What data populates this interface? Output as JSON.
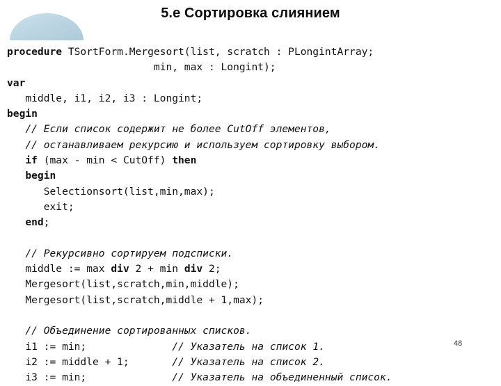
{
  "slide": {
    "title": "5.е Сортировка слиянием",
    "page_number": "48",
    "accent_color": "#bcd6e3",
    "text_color": "#111111",
    "background_color": "#ffffff"
  },
  "decoration": {
    "shape_name": "half-ellipse-dome",
    "fill": "#bcd6e3"
  },
  "code": {
    "language": "Pascal",
    "lines": [
      {
        "id": "l01",
        "segments": [
          {
            "t": "procedure",
            "s": "kw"
          },
          {
            "t": " TSortForm.Mergesort(list, scratch : PLongintArray;",
            "s": "plain"
          }
        ]
      },
      {
        "id": "l02",
        "segments": [
          {
            "t": "                        min, max : Longint);",
            "s": "plain"
          }
        ]
      },
      {
        "id": "l03",
        "segments": [
          {
            "t": "var",
            "s": "kw"
          }
        ]
      },
      {
        "id": "l04",
        "segments": [
          {
            "t": "   middle, i1, i2, i3 : Longint;",
            "s": "plain"
          }
        ]
      },
      {
        "id": "l05",
        "segments": [
          {
            "t": "begin",
            "s": "kw"
          }
        ]
      },
      {
        "id": "l06",
        "segments": [
          {
            "t": "   ",
            "s": "plain"
          },
          {
            "t": "// Если список содержит не более CutOff элементов,",
            "s": "cmt"
          }
        ]
      },
      {
        "id": "l07",
        "segments": [
          {
            "t": "   ",
            "s": "plain"
          },
          {
            "t": "// останавливаем рекурсию и используем сортировку выбором.",
            "s": "cmt"
          }
        ]
      },
      {
        "id": "l08",
        "segments": [
          {
            "t": "   ",
            "s": "plain"
          },
          {
            "t": "if",
            "s": "kw"
          },
          {
            "t": " (max - min < CutOff) ",
            "s": "plain"
          },
          {
            "t": "then",
            "s": "kw"
          }
        ]
      },
      {
        "id": "l09",
        "segments": [
          {
            "t": "   ",
            "s": "plain"
          },
          {
            "t": "begin",
            "s": "kw"
          }
        ]
      },
      {
        "id": "l10",
        "segments": [
          {
            "t": "      Selectionsort(list,min,max);",
            "s": "plain"
          }
        ]
      },
      {
        "id": "l11",
        "segments": [
          {
            "t": "      exit;",
            "s": "plain"
          }
        ]
      },
      {
        "id": "l12",
        "segments": [
          {
            "t": "   ",
            "s": "plain"
          },
          {
            "t": "end",
            "s": "kw"
          },
          {
            "t": ";",
            "s": "plain"
          }
        ]
      },
      {
        "id": "l13",
        "segments": [
          {
            "t": "",
            "s": "plain"
          }
        ]
      },
      {
        "id": "l14",
        "segments": [
          {
            "t": "   ",
            "s": "plain"
          },
          {
            "t": "// Рекурсивно сортируем подсписки.",
            "s": "cmt"
          }
        ]
      },
      {
        "id": "l15",
        "segments": [
          {
            "t": "   middle := max ",
            "s": "plain"
          },
          {
            "t": "div",
            "s": "kw"
          },
          {
            "t": " 2 + min ",
            "s": "plain"
          },
          {
            "t": "div",
            "s": "kw"
          },
          {
            "t": " 2;",
            "s": "plain"
          }
        ]
      },
      {
        "id": "l16",
        "segments": [
          {
            "t": "   Mergesort(list,scratch,min,middle);",
            "s": "plain"
          }
        ]
      },
      {
        "id": "l17",
        "segments": [
          {
            "t": "   Mergesort(list,scratch,middle + 1,max);",
            "s": "plain"
          }
        ]
      },
      {
        "id": "l18",
        "segments": [
          {
            "t": "",
            "s": "plain"
          }
        ]
      },
      {
        "id": "l19",
        "segments": [
          {
            "t": "   ",
            "s": "plain"
          },
          {
            "t": "// Объединение сортированных списков.",
            "s": "cmt"
          }
        ]
      },
      {
        "id": "l20",
        "segments": [
          {
            "t": "   i1 := min;              ",
            "s": "plain"
          },
          {
            "t": "// Указатель на список 1.",
            "s": "cmt"
          }
        ]
      },
      {
        "id": "l21",
        "segments": [
          {
            "t": "   i2 := middle + 1;       ",
            "s": "plain"
          },
          {
            "t": "// Указатель на список 2.",
            "s": "cmt"
          }
        ]
      },
      {
        "id": "l22",
        "segments": [
          {
            "t": "   i3 := min;              ",
            "s": "plain"
          },
          {
            "t": "// Указатель на объединенный список.",
            "s": "cmt"
          }
        ]
      }
    ]
  }
}
